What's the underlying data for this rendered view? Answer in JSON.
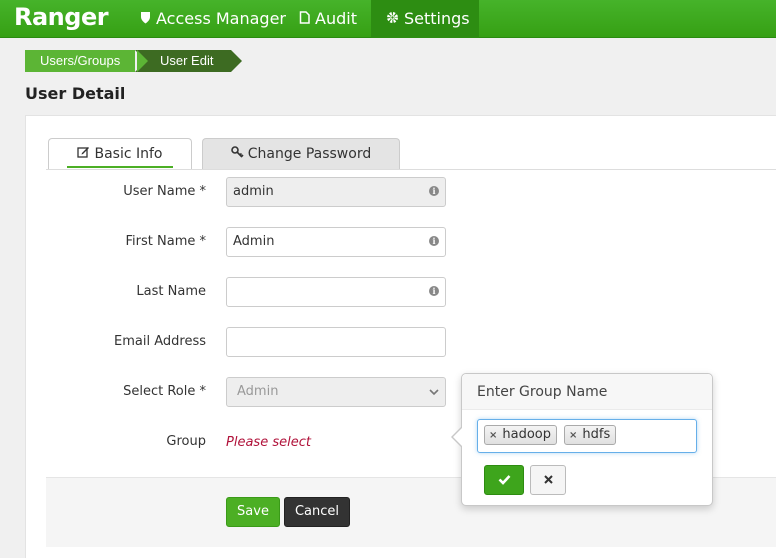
{
  "nav": {
    "brand": "Ranger",
    "items": [
      {
        "label": "Access Manager",
        "icon": "shield-icon"
      },
      {
        "label": "Audit",
        "icon": "file-icon"
      },
      {
        "label": "Settings",
        "icon": "gear-icon",
        "active": true
      }
    ]
  },
  "breadcrumb": [
    "Users/Groups",
    "User Edit"
  ],
  "page_title": "User Detail",
  "tabs": [
    {
      "label": "Basic Info",
      "icon": "edit-icon",
      "active": true
    },
    {
      "label": "Change Password",
      "icon": "key-icon",
      "active": false
    }
  ],
  "form": {
    "user_name": {
      "label": "User Name *",
      "value": "admin"
    },
    "first_name": {
      "label": "First Name *",
      "value": "Admin"
    },
    "last_name": {
      "label": "Last Name",
      "value": ""
    },
    "email": {
      "label": "Email Address",
      "value": ""
    },
    "role": {
      "label": "Select Role *",
      "value": "Admin"
    },
    "group": {
      "label": "Group",
      "placeholder_text": "Please select"
    }
  },
  "buttons": {
    "save": "Save",
    "cancel": "Cancel"
  },
  "group_popover": {
    "title": "Enter Group Name",
    "tags": [
      "hadoop",
      "hdfs"
    ],
    "remove_glyph": "×",
    "ok_icon": "check-icon",
    "cancel_icon": "close-icon"
  },
  "colors": {
    "nav_green": "#3aa619",
    "save_green": "#4caf24",
    "error_red": "#b0123a"
  }
}
